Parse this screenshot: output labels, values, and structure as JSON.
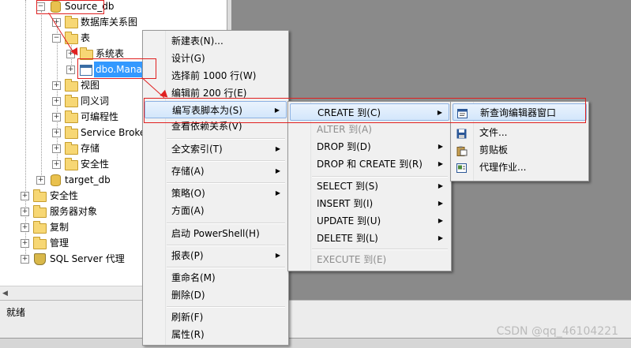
{
  "tree": {
    "nodes": [
      {
        "label": "Source_db",
        "icon": "database-icon",
        "expander": "−"
      },
      {
        "label": "数据库关系图",
        "icon": "folder-icon",
        "expander": "+"
      },
      {
        "label": "表",
        "icon": "folder-icon",
        "expander": "−"
      },
      {
        "label": "系统表",
        "icon": "folder-icon",
        "expander": "+"
      },
      {
        "label": "dbo.Mana",
        "icon": "table-icon",
        "expander": "+"
      },
      {
        "label": "视图",
        "icon": "folder-icon",
        "expander": "+"
      },
      {
        "label": "同义词",
        "icon": "folder-icon",
        "expander": "+"
      },
      {
        "label": "可编程性",
        "icon": "folder-icon",
        "expander": "+"
      },
      {
        "label": "Service Broke",
        "icon": "folder-icon",
        "expander": "+"
      },
      {
        "label": "存储",
        "icon": "folder-icon",
        "expander": "+"
      },
      {
        "label": "安全性",
        "icon": "folder-icon",
        "expander": "+"
      },
      {
        "label": "target_db",
        "icon": "database-icon",
        "expander": "+"
      },
      {
        "label": "安全性",
        "icon": "folder-icon",
        "expander": "+"
      },
      {
        "label": "服务器对象",
        "icon": "folder-icon",
        "expander": "+"
      },
      {
        "label": "复制",
        "icon": "folder-icon",
        "expander": "+"
      },
      {
        "label": "管理",
        "icon": "folder-icon",
        "expander": "+"
      },
      {
        "label": "SQL Server 代理",
        "icon": "agent-icon",
        "expander": "+"
      }
    ]
  },
  "context_menu": {
    "items": [
      {
        "label": "新建表(N)..."
      },
      {
        "label": "设计(G)"
      },
      {
        "label": "选择前 1000 行(W)"
      },
      {
        "label": "编辑前 200 行(E)"
      },
      {
        "label": "编写表脚本为(S)",
        "submenu": "true"
      },
      {
        "label": "查看依赖关系(V)"
      },
      {
        "label": "全文索引(T)",
        "submenu": "true"
      },
      {
        "label": "存储(A)",
        "submenu": "true"
      },
      {
        "label": "策略(O)",
        "submenu": "true"
      },
      {
        "label": "方面(A)"
      },
      {
        "label": "启动 PowerShell(H)"
      },
      {
        "label": "报表(P)",
        "submenu": "true"
      },
      {
        "label": "重命名(M)"
      },
      {
        "label": "删除(D)"
      },
      {
        "label": "刷新(F)"
      },
      {
        "label": "属性(R)"
      }
    ]
  },
  "script_menu": {
    "items": [
      {
        "label": "CREATE 到(C)",
        "submenu": "true"
      },
      {
        "label": "ALTER 到(A)",
        "disabled": "true"
      },
      {
        "label": "DROP 到(D)",
        "submenu": "true"
      },
      {
        "label": "DROP 和 CREATE 到(R)",
        "submenu": "true"
      },
      {
        "label": "SELECT 到(S)",
        "submenu": "true"
      },
      {
        "label": "INSERT 到(I)",
        "submenu": "true"
      },
      {
        "label": "UPDATE 到(U)",
        "submenu": "true"
      },
      {
        "label": "DELETE 到(L)",
        "submenu": "true"
      },
      {
        "label": "EXECUTE 到(E)",
        "disabled": "true"
      }
    ]
  },
  "create_menu": {
    "items": [
      {
        "label": "新查询编辑器窗口",
        "icon": "query-window-icon"
      },
      {
        "label": "文件...",
        "icon": "save-icon"
      },
      {
        "label": "剪贴板",
        "icon": "clipboard-icon"
      },
      {
        "label": "代理作业...",
        "icon": "agent-job-icon"
      }
    ]
  },
  "status": {
    "text": "就绪"
  },
  "watermark": "CSDN @qq_46104221",
  "colors": {
    "highlight": "#3399ff",
    "annotation": "#e02020"
  }
}
